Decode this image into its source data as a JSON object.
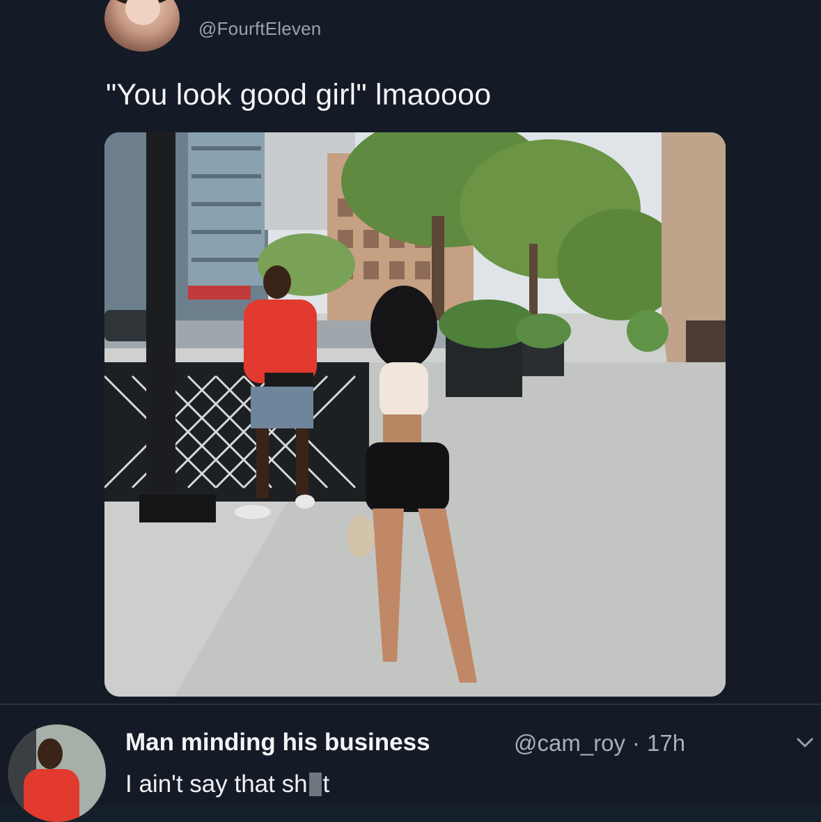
{
  "tweet": {
    "handle": "@FourftEleven",
    "text": "\"You look good girl\" lmaoooo"
  },
  "reply": {
    "display_name": "Man minding his business",
    "handle": "@cam_roy",
    "separator": "·",
    "time": "17h",
    "text_before": "I ain't say that sh",
    "text_after": "t",
    "censored": true
  },
  "icons": {
    "menu": "chevron-down-icon"
  },
  "colors": {
    "background": "#151b26",
    "primary_text": "#f3f4f6",
    "secondary_text": "#9aa3ad"
  }
}
